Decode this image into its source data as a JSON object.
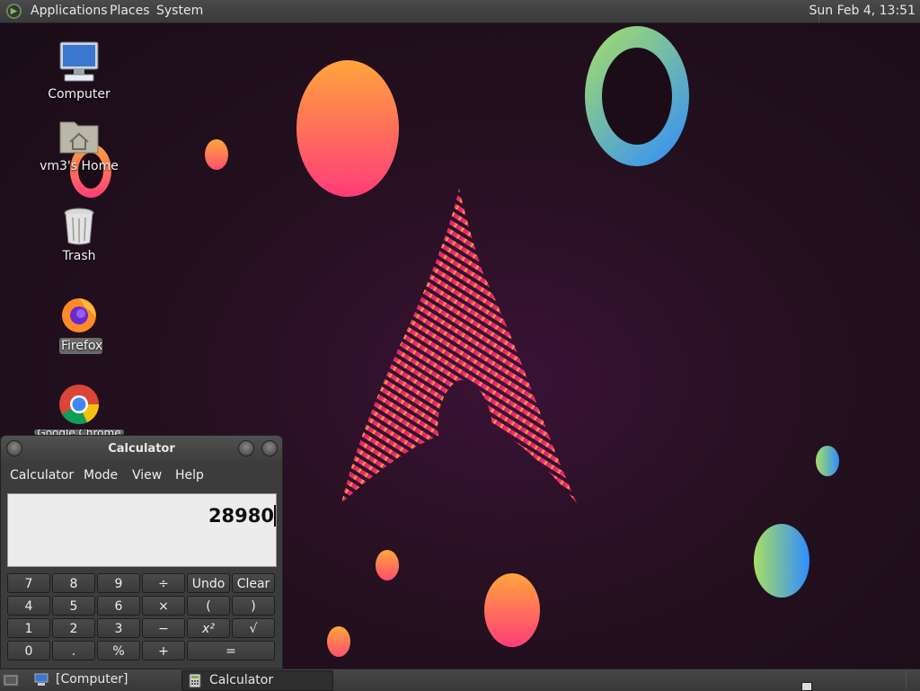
{
  "top_panel": {
    "menus": [
      "Applications",
      "Places",
      "System"
    ],
    "clock": "Sun Feb  4, 13:51"
  },
  "desktop_icons": [
    {
      "label": "Computer",
      "icon": "computer-icon"
    },
    {
      "label": "vm3's Home",
      "icon": "home-folder-icon"
    },
    {
      "label": "Trash",
      "icon": "trash-icon"
    },
    {
      "label": "Firefox",
      "icon": "firefox-icon"
    },
    {
      "label": "Google Chrome",
      "icon": "chrome-icon"
    }
  ],
  "calculator": {
    "title": "Calculator",
    "menus": [
      "Calculator",
      "Mode",
      "View",
      "Help"
    ],
    "display_value": "28980",
    "keys": [
      [
        "7",
        "8",
        "9",
        "÷",
        "Undo",
        "Clear"
      ],
      [
        "4",
        "5",
        "6",
        "×",
        "(",
        ")"
      ],
      [
        "1",
        "2",
        "3",
        "−",
        "x²",
        "√"
      ],
      [
        "0",
        ".",
        "%",
        "+",
        "="
      ]
    ]
  },
  "taskbar": {
    "tasks": [
      {
        "label": "[Computer]",
        "icon": "computer-icon",
        "active": false
      },
      {
        "label": "Calculator",
        "icon": "calculator-icon",
        "active": true
      }
    ]
  },
  "colors": {
    "arch_logo_top": "#e0206e",
    "arch_logo_bottom": "#f7c235",
    "ring_start": "#a8e063",
    "ring_end": "#2f8cff",
    "orb_warm_start": "#ffa53b",
    "orb_warm_end": "#ff3c7a"
  }
}
